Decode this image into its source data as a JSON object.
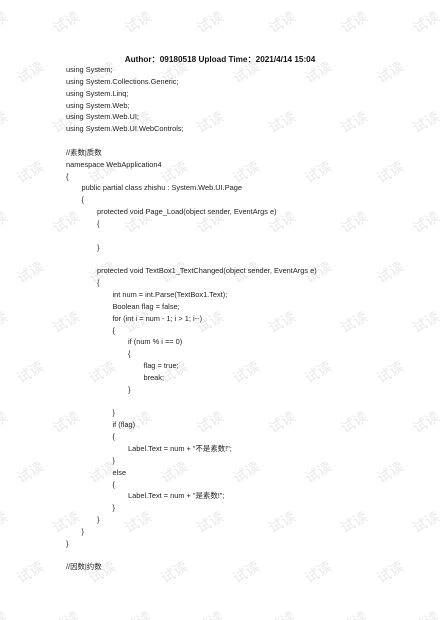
{
  "watermark": {
    "text": "试读",
    "color": "#e9e9e9"
  },
  "header": {
    "author_label": "Author：",
    "author_value": "09180518",
    "upload_label": "Upload Time：",
    "upload_value": "2021/4/14 15:04"
  },
  "code_lines": [
    {
      "indent": 0,
      "text": "using System;"
    },
    {
      "indent": 0,
      "text": "using System.Collections.Generic;"
    },
    {
      "indent": 0,
      "text": "using System.Linq;"
    },
    {
      "indent": 0,
      "text": "using System.Web;"
    },
    {
      "indent": 0,
      "text": "using System.Web.UI;"
    },
    {
      "indent": 0,
      "text": "using System.Web.UI.WebControls;"
    },
    {
      "indent": 0,
      "text": ""
    },
    {
      "indent": 0,
      "text": "//素数|质数"
    },
    {
      "indent": 0,
      "text": "namespace WebApplication4"
    },
    {
      "indent": 0,
      "text": "{"
    },
    {
      "indent": 1,
      "text": "public partial class zhishu : System.Web.UI.Page"
    },
    {
      "indent": 1,
      "text": "{"
    },
    {
      "indent": 2,
      "text": "protected void Page_Load(object sender, EventArgs e)"
    },
    {
      "indent": 2,
      "text": "{"
    },
    {
      "indent": 0,
      "text": ""
    },
    {
      "indent": 2,
      "text": "}"
    },
    {
      "indent": 0,
      "text": ""
    },
    {
      "indent": 2,
      "text": "protected void TextBox1_TextChanged(object sender, EventArgs e)"
    },
    {
      "indent": 2,
      "text": "{"
    },
    {
      "indent": 3,
      "text": "int num = int.Parse(TextBox1.Text);"
    },
    {
      "indent": 3,
      "text": "Boolean flag = false;"
    },
    {
      "indent": 3,
      "text": "for (int i = num - 1; i > 1; i--)"
    },
    {
      "indent": 3,
      "text": "{"
    },
    {
      "indent": 4,
      "text": "if (num % i == 0)"
    },
    {
      "indent": 4,
      "text": "{"
    },
    {
      "indent": 5,
      "text": "flag = true;"
    },
    {
      "indent": 5,
      "text": "break;"
    },
    {
      "indent": 4,
      "text": "}"
    },
    {
      "indent": 0,
      "text": ""
    },
    {
      "indent": 3,
      "text": "}"
    },
    {
      "indent": 3,
      "text": "if (flag)"
    },
    {
      "indent": 3,
      "text": "{"
    },
    {
      "indent": 4,
      "text": "Label.Text = num + \"不是素数!\";"
    },
    {
      "indent": 3,
      "text": "}"
    },
    {
      "indent": 3,
      "text": "else"
    },
    {
      "indent": 3,
      "text": "{"
    },
    {
      "indent": 4,
      "text": "Label.Text = num + \"是素数!\";"
    },
    {
      "indent": 3,
      "text": "}"
    },
    {
      "indent": 2,
      "text": "}"
    },
    {
      "indent": 1,
      "text": "}"
    },
    {
      "indent": 0,
      "text": "}"
    },
    {
      "indent": 0,
      "text": ""
    },
    {
      "indent": 0,
      "text": "//因数|约数"
    }
  ]
}
